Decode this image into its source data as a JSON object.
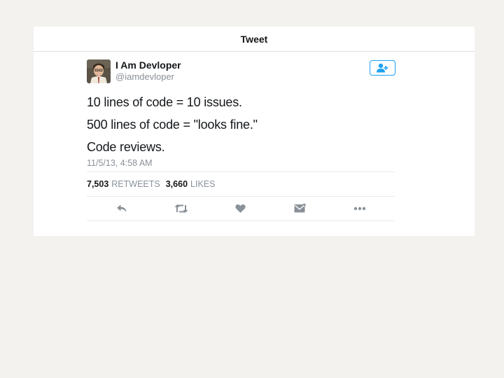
{
  "header": {
    "title": "Tweet"
  },
  "author": {
    "display_name": "I Am Devloper",
    "username": "@iamdevloper"
  },
  "tweet": {
    "lines": [
      "10 lines of code = 10 issues.",
      "500 lines of code = \"looks fine.\"",
      "Code reviews."
    ],
    "timestamp": "11/5/13, 4:58 AM"
  },
  "stats": {
    "retweets_count": "7,503",
    "retweets_label": "RETWEETS",
    "likes_count": "3,660",
    "likes_label": "LIKES"
  },
  "actions": [
    {
      "icon": "reply-icon"
    },
    {
      "icon": "retweet-icon"
    },
    {
      "icon": "heart-icon"
    },
    {
      "icon": "direct-message-icon"
    },
    {
      "icon": "more-icon"
    }
  ],
  "colors": {
    "accent": "#1da1f2",
    "icon_gray": "#8a9199",
    "text": "#14171a",
    "background": "#f3f2ee"
  }
}
